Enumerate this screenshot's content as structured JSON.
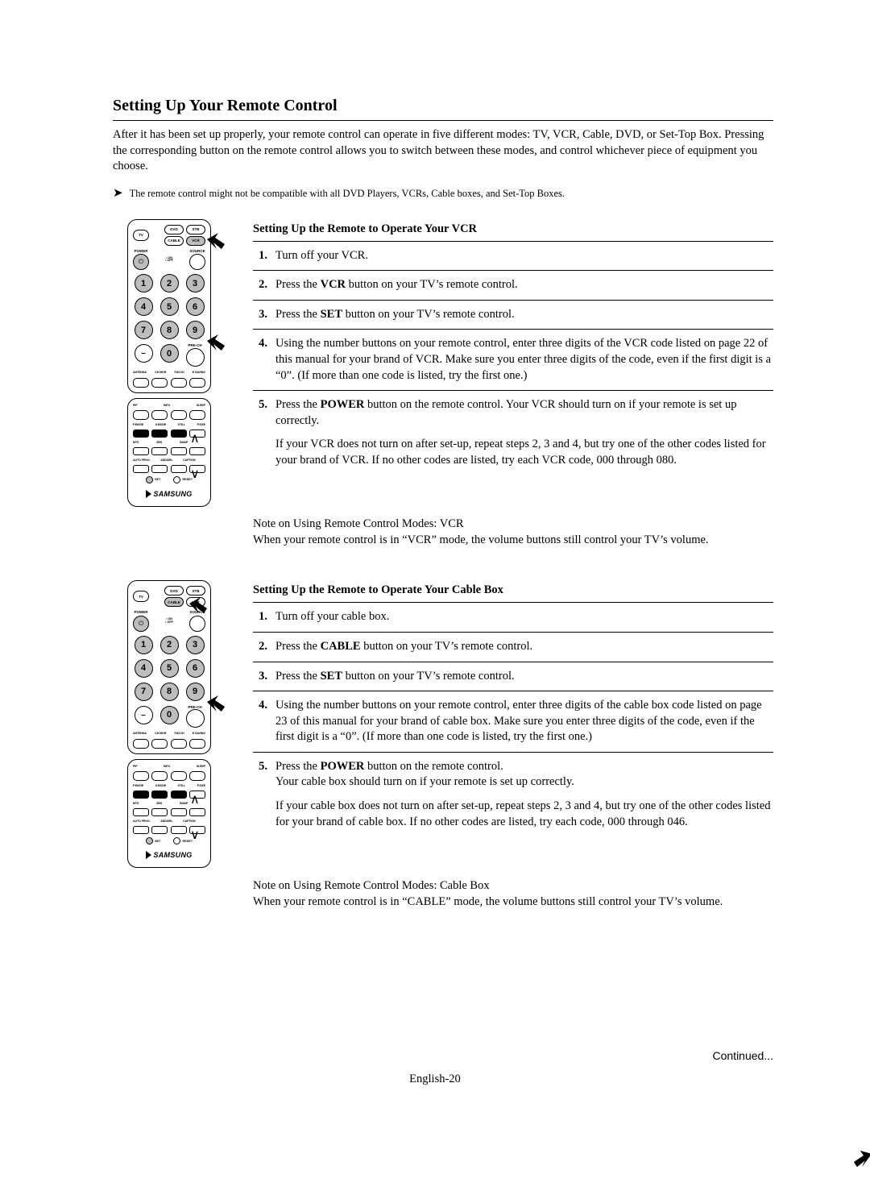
{
  "title": "Setting Up Your Remote Control",
  "intro": "After it has been set up properly, your remote control can operate in five different modes: TV, VCR, Cable, DVD, or Set-Top Box. Pressing the corresponding button on the remote control allows you to switch between these modes, and control whichever piece of equipment you choose.",
  "compat_note": "The remote control might not be compatible with all DVD Players, VCRs, Cable boxes, and Set-Top Boxes.",
  "vcr": {
    "heading": "Setting Up the Remote to Operate Your VCR",
    "steps": [
      {
        "n": "1.",
        "html": "Turn off your VCR."
      },
      {
        "n": "2.",
        "html": "Press the <b>VCR</b> button on your TV’s remote control."
      },
      {
        "n": "3.",
        "html": "Press the <b>SET</b> button on your TV’s remote control."
      },
      {
        "n": "4.",
        "html": "Using the number buttons on your remote control, enter three digits of the VCR code listed on page 22 of this manual for your brand of VCR. Make sure you enter three digits of the code, even if the first digit is a “0”. (If more than one code is listed, try the first one.)"
      },
      {
        "n": "5.",
        "html": "Press the <b>POWER</b> button on the remote control. Your VCR should turn on if your remote is set up correctly."
      }
    ],
    "after": "If your VCR does not turn on after set-up, repeat steps 2, 3 and 4, but try one of the other codes listed for your brand of VCR. If no other codes are listed, try each VCR code, 000 through 080.",
    "note_title": "Note on Using Remote Control Modes: VCR",
    "note_body": "When your remote control is in “VCR” mode, the volume buttons still control your TV’s volume."
  },
  "cable": {
    "heading": "Setting Up the Remote to Operate Your Cable Box",
    "steps": [
      {
        "n": "1.",
        "html": "Turn off your cable box."
      },
      {
        "n": "2.",
        "html": "Press the <b>CABLE</b> button on your TV’s remote control."
      },
      {
        "n": "3.",
        "html": "Press the <b>SET</b> button on your TV’s remote control."
      },
      {
        "n": "4.",
        "html": "Using the number buttons on your remote control, enter three digits of the cable box code listed on page 23 of this manual for your brand of cable box. Make sure you enter three digits of the code, even if the first digit is a “0”. (If more than one code is listed, try the first one.)"
      },
      {
        "n": "5.",
        "html": "Press the <b>POWER</b> button on the remote control.<br>Your cable box should turn on if your remote is set up correctly."
      }
    ],
    "after": "If your cable box does not turn on after set-up, repeat steps 2, 3 and 4, but try one of the other codes listed for your brand of cable box. If no other codes are listed, try each code, 000 through 046.",
    "note_title": "Note on Using Remote Control Modes: Cable Box",
    "note_body": "When your remote control is in “CABLE” mode, the volume buttons still control your TV’s volume."
  },
  "remote": {
    "mode_tv": "TV",
    "mode_dvd": "DVD",
    "mode_stb": "STB",
    "mode_cable": "CABLE",
    "mode_vcr": "VCR",
    "power": "POWER",
    "source": "SOURCE",
    "prech": "PRE-CH",
    "antenna": "ANTENNA",
    "chmgr": "CH MGR",
    "favch": "FAV.CH",
    "esaving": "E.SAVING",
    "pip": "PIP",
    "info": "INFO",
    "sleep": "SLEEP",
    "pmode": "P.MODE",
    "smode": "S.MODE",
    "still": "STILL",
    "psize": "P.SIZE",
    "mts": "MTS",
    "srs": "SRS",
    "swap": "SWAP",
    "autoprog": "AUTO PROG.",
    "add_del": "ADD/DEL",
    "caption": "CAPTION",
    "set": "SET",
    "reset": "RESET",
    "brand": "SAMSUNG",
    "n1": "1",
    "n2": "2",
    "n3": "3",
    "n4": "4",
    "n5": "5",
    "n6": "6",
    "n7": "7",
    "n8": "8",
    "n9": "9",
    "n0": "0"
  },
  "continued": "Continued...",
  "page_number": "English-20"
}
